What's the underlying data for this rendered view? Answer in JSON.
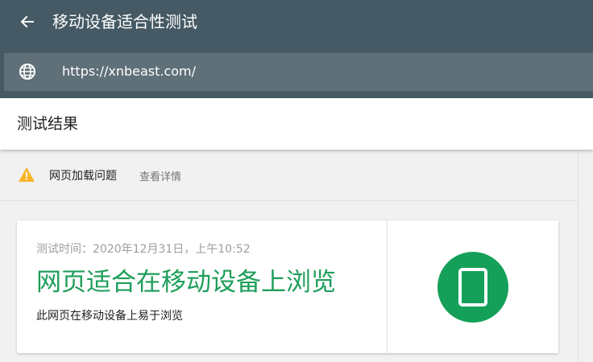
{
  "header": {
    "title": "移动设备适合性测试",
    "url": "https://xnbeast.com/"
  },
  "results": {
    "title": "测试结果"
  },
  "issue": {
    "label": "网页加载问题",
    "link": "查看详情",
    "icon": "warning-icon",
    "color": "#f9b52a"
  },
  "card": {
    "test_time": "测试时间：2020年12月31日，上午10:52",
    "verdict": "网页适合在移动设备上浏览",
    "subtitle": "此网页在移动设备上易于浏览",
    "badge_icon": "mobile-phone-icon",
    "accent": "#1e9e5a"
  },
  "colors": {
    "topbar": "#455a64",
    "url_bar": "#607078"
  }
}
